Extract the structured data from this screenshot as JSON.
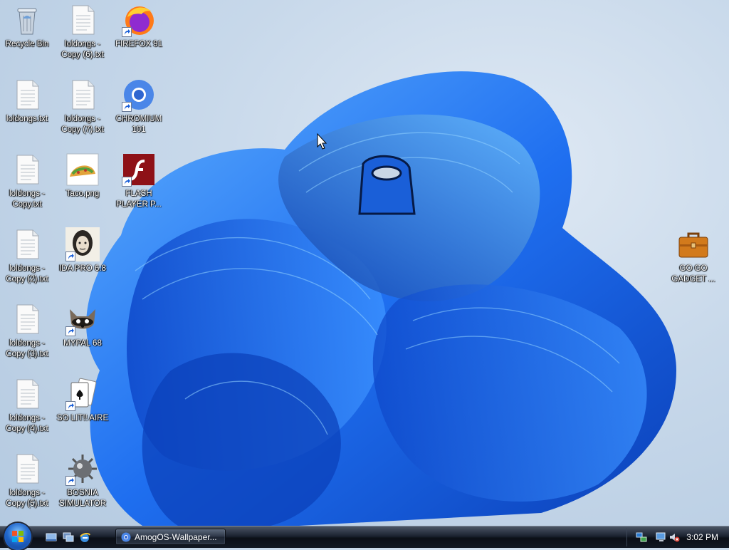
{
  "desktop": {
    "icons": [
      {
        "label": "Recycle Bin",
        "kind": "recycle-bin",
        "shortcut": false
      },
      {
        "label": "loldongs - Copy (6).txt",
        "kind": "text-file",
        "shortcut": false
      },
      {
        "label": "FIREFOX 91",
        "kind": "firefox",
        "shortcut": true
      },
      {
        "label": "loldongs.txt",
        "kind": "text-file",
        "shortcut": false
      },
      {
        "label": "loldongs - Copy (7).txt",
        "kind": "text-file",
        "shortcut": false
      },
      {
        "label": "CHROMIUM 101",
        "kind": "chromium",
        "shortcut": true
      },
      {
        "label": "loldongs - Copy.txt",
        "kind": "text-file",
        "shortcut": false
      },
      {
        "label": "Taco.png",
        "kind": "image-file",
        "shortcut": false
      },
      {
        "label": "FLASH PLAYER P...",
        "kind": "flash",
        "shortcut": true
      },
      {
        "label": "loldongs - Copy (2).txt",
        "kind": "text-file",
        "shortcut": false
      },
      {
        "label": "IDA PRO 6.8",
        "kind": "ida-pro",
        "shortcut": true
      },
      {
        "label": "loldongs - Copy (3).txt",
        "kind": "text-file",
        "shortcut": false
      },
      {
        "label": "MYPAL 68",
        "kind": "mypal",
        "shortcut": true
      },
      {
        "label": "loldongs - Copy (4).txt",
        "kind": "text-file",
        "shortcut": false
      },
      {
        "label": "SO LIT!! AIRE",
        "kind": "solitaire",
        "shortcut": true
      },
      {
        "label": "loldongs - Copy (5).txt",
        "kind": "text-file",
        "shortcut": false
      },
      {
        "label": "BOSNIA SIMULATOR",
        "kind": "minesweeper",
        "shortcut": true
      },
      {
        "label": "GO GO GADGET ...",
        "kind": "briefcase",
        "shortcut": false
      }
    ]
  },
  "taskbar": {
    "start_icon": "windows-orb-icon",
    "quick_launch": [
      "show-desktop-icon",
      "switch-windows-icon",
      "internet-explorer-icon"
    ],
    "task_button": {
      "label": "AmogOS-Wallpaper...",
      "icon": "chromium-icon"
    },
    "tray_icons": [
      "network-icon",
      "monitor-icon",
      "volume-muted-icon"
    ],
    "clock": "3:02 PM"
  },
  "colors": {
    "accent": "#1e64c8",
    "taskbar": "#121823"
  }
}
